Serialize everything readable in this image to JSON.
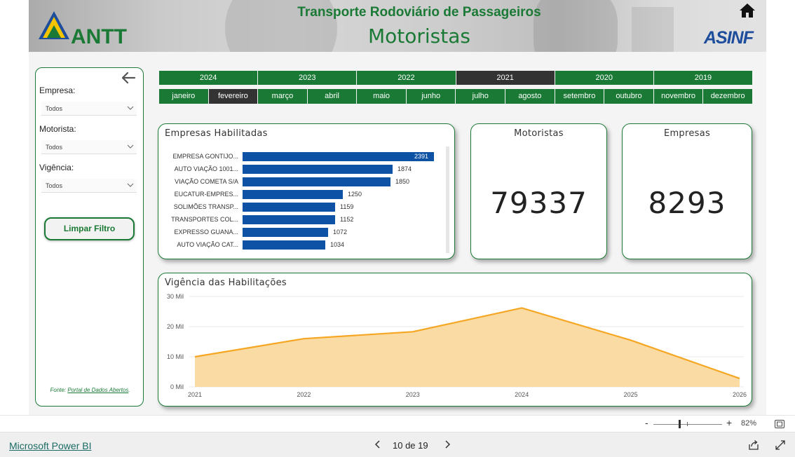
{
  "header": {
    "title": "Transporte Rodoviário de Passageiros",
    "subtitle": "Motoristas",
    "logo_left": "ANTT",
    "logo_right": "ASINF",
    "home_icon": "home-icon"
  },
  "sidebar": {
    "filters": [
      {
        "label": "Empresa:",
        "value": "Todos"
      },
      {
        "label": "Motorista:",
        "value": "Todos"
      },
      {
        "label": "Vigência:",
        "value": "Todos"
      }
    ],
    "clear_button": "Limpar Filtro",
    "source_prefix": "Fonte: ",
    "source_link": "Portal de Dados Abertos",
    "source_suffix": "."
  },
  "years": [
    "2024",
    "2023",
    "2022",
    "2021",
    "2020",
    "2019"
  ],
  "selected_year": "2021",
  "months": [
    "janeiro",
    "fevereiro",
    "março",
    "abril",
    "maio",
    "junho",
    "julho",
    "agosto",
    "setembro",
    "outubro",
    "novembro",
    "dezembro"
  ],
  "selected_month": "fevereiro",
  "cards": {
    "empresas_habilitadas_title": "Empresas Habilitadas",
    "motoristas_title": "Motoristas",
    "motoristas_value": "79337",
    "empresas_title": "Empresas",
    "empresas_value": "8293",
    "vigencia_title": "Vigência das Habilitações"
  },
  "chart_data": [
    {
      "type": "bar",
      "title": "Empresas Habilitadas",
      "orientation": "horizontal",
      "categories": [
        "EMPRESA GONTIJO...",
        "AUTO VIAÇÃO 1001...",
        "VIAÇÃO COMETA S/A",
        "EUCATUR-EMPRES...",
        "SOLIMÕES TRANSP...",
        "TRANSPORTES COL...",
        "EXPRESSO GUANA...",
        "AUTO VIAÇÃO CAT..."
      ],
      "values": [
        2391,
        1874,
        1850,
        1250,
        1159,
        1152,
        1072,
        1034
      ],
      "color": "#0d52a4"
    },
    {
      "type": "area",
      "title": "Vigência das Habilitações",
      "x": [
        "2021",
        "2022",
        "2023",
        "2024",
        "2025",
        "2026"
      ],
      "values": [
        10000,
        16000,
        18300,
        26200,
        15500,
        2800
      ],
      "y_ticks": [
        "0 Mil",
        "10 Mil",
        "20 Mil",
        "30 Mil"
      ],
      "ylim": [
        0,
        30000
      ],
      "line_color": "#f5a623",
      "fill_color": "#f9d594"
    }
  ],
  "bottom_bar": {
    "zoom_minus": "-",
    "zoom_plus": "+",
    "zoom_level": "82%",
    "powerbi_link": "Microsoft Power BI",
    "page_indicator": "10 de 19"
  }
}
